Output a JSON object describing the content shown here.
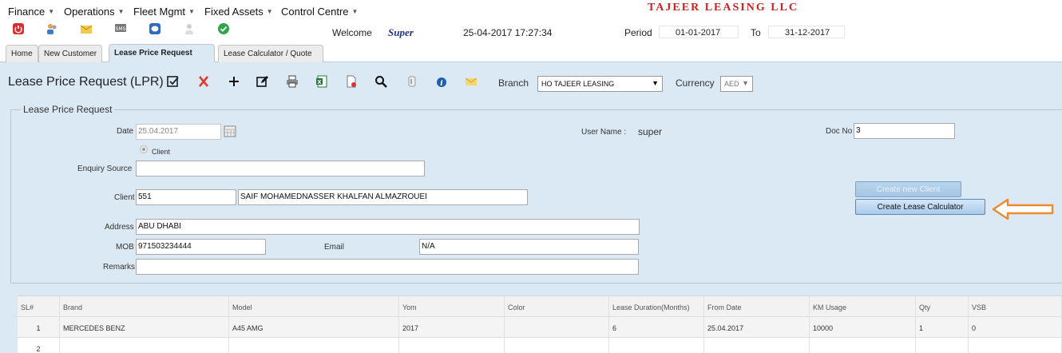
{
  "menu": {
    "items": [
      "Finance",
      "Operations",
      "Fleet Mgmt",
      "Fixed Assets",
      "Control Centre"
    ],
    "company": "TAJEER LEASING LLC"
  },
  "topbar": {
    "welcome": "Welcome",
    "user": "Super",
    "datetime": "25-04-2017 17:27:34",
    "period_label": "Period",
    "period_from": "01-01-2017",
    "to_label": "To",
    "period_to": "31-12-2017",
    "icons": [
      "power-icon",
      "users-icon",
      "mail-icon",
      "sms-icon",
      "chat-icon",
      "user-icon",
      "check-icon"
    ]
  },
  "tabs": [
    "Home",
    "New Customer",
    "Lease Price Request",
    "Lease Calculator / Quote"
  ],
  "page": {
    "title": "Lease Price Request (LPR)",
    "branch_label": "Branch",
    "branch_value": "HO TAJEER LEASING",
    "currency_label": "Currency",
    "currency_value": "AED"
  },
  "form": {
    "legend": "Lease Price Request",
    "date_label": "Date",
    "date_value": "25.04.2017",
    "client_radio": "Client",
    "enquiry_label": "Enquiry Source",
    "enquiry_value": "",
    "client_label": "Client",
    "client_code": "551",
    "client_name": "SAIF MOHAMEDNASSER KHALFAN ALMAZROUEI",
    "address_label": "Address",
    "address_value": "ABU DHABI",
    "mob_label": "MOB",
    "mob_value": "971503234444",
    "email_label": "Email",
    "email_value": "N/A",
    "remarks_label": "Remarks",
    "remarks_value": "",
    "username_label": "User Name :",
    "username_value": "super",
    "docno_label": "Doc No",
    "docno_value": "3",
    "create_client_btn": "Create new Client",
    "create_calc_btn": "Create Lease Calculator"
  },
  "grid": {
    "columns": [
      "SL#",
      "Brand",
      "Model",
      "Yom",
      "Color",
      "Lease Duration(Months)",
      "From Date",
      "KM Usage",
      "Qty",
      "VSB"
    ],
    "rows": [
      [
        "1",
        "MERCEDES BENZ",
        "A45 AMG",
        "2017",
        "",
        "6",
        "25.04.2017",
        "10000",
        "1",
        "0"
      ],
      [
        "2",
        "",
        "",
        "",
        "",
        "",
        "",
        "",
        "",
        ""
      ]
    ]
  },
  "colors": {
    "content_bg": "#dbe9f4",
    "company_red": "#cc2222",
    "arrow_orange": "#f08a2c"
  }
}
